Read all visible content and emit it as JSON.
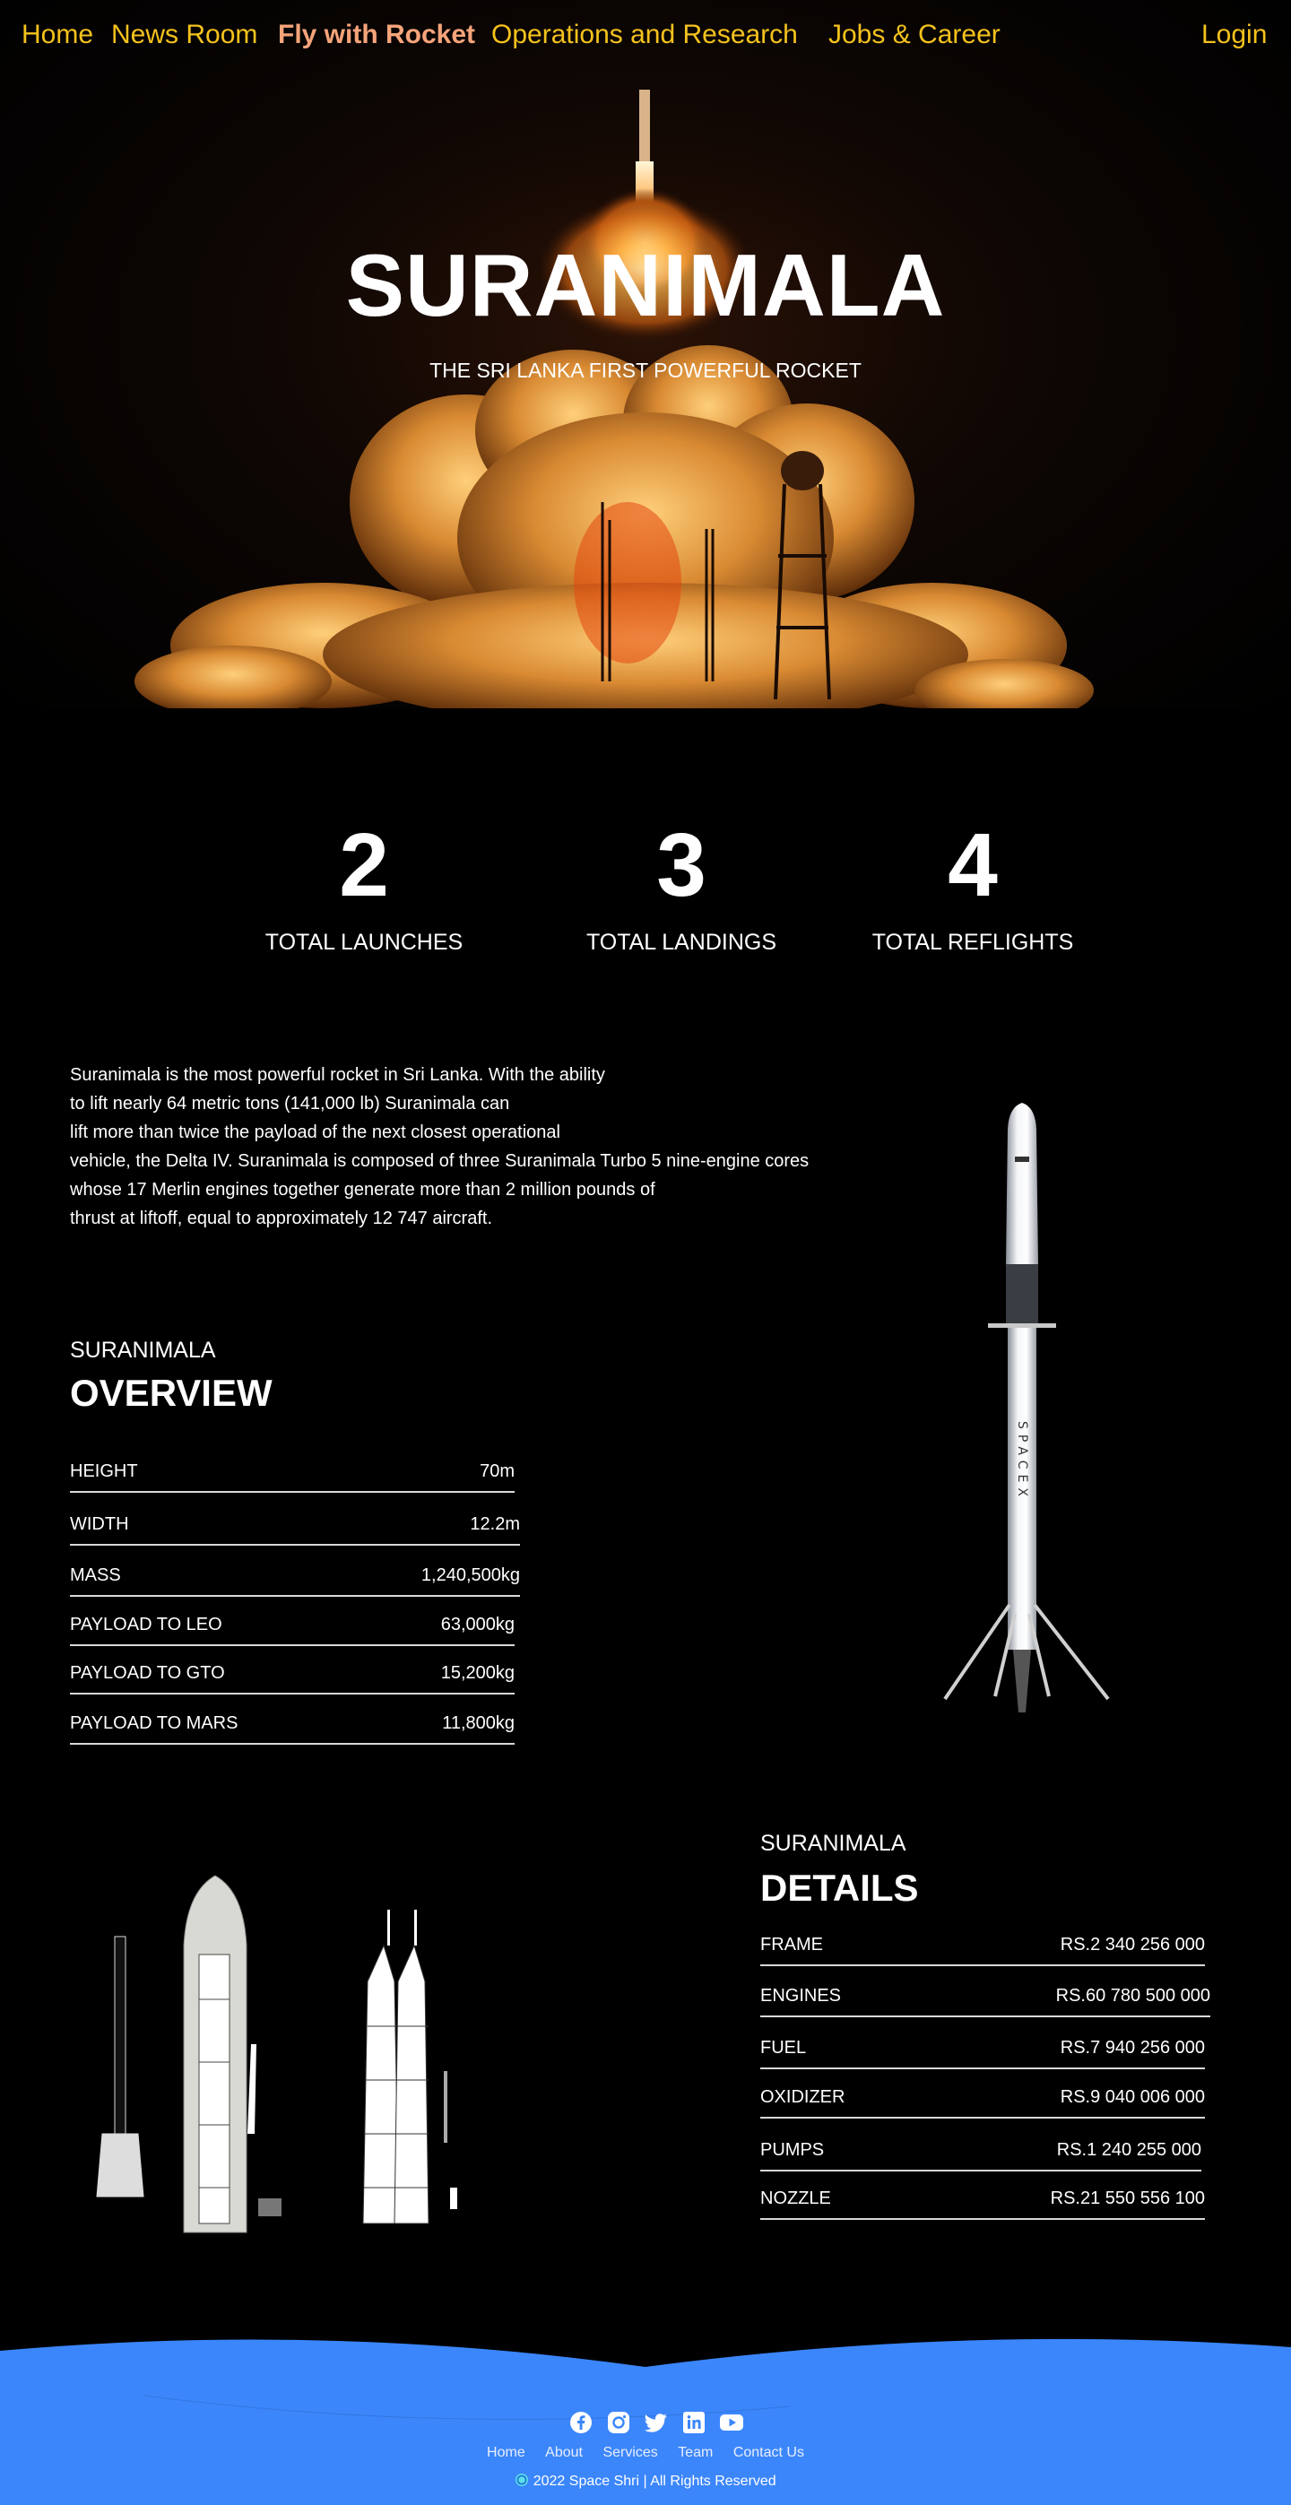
{
  "nav": {
    "home": "Home",
    "news": "News Room",
    "fly": "Fly with Rocket",
    "ops": "Operations and Research",
    "jobs": "Jobs & Career",
    "login": "Login"
  },
  "hero": {
    "title": "SURANIMALA",
    "subtitle": "THE SRI LANKA FIRST POWERFUL ROCKET"
  },
  "stats": [
    {
      "value": "2",
      "label": "TOTAL LAUNCHES"
    },
    {
      "value": "3",
      "label": "TOTAL LANDINGS"
    },
    {
      "value": "4",
      "label": "TOTAL REFLIGHTS"
    }
  ],
  "description": [
    "Suranimala is the most powerful rocket in Sri Lanka. With the ability",
    "to lift nearly 64 metric tons (141,000 lb) Suranimala can",
    "lift more than twice the payload of the next closest operational",
    "vehicle, the Delta IV. Suranimala is composed of three Suranimala Turbo 5 nine-engine cores",
    "whose 17 Merlin engines together generate more than 2 million pounds of",
    "thrust at liftoff, equal to approximately 12 747 aircraft."
  ],
  "overview": {
    "kicker": "SURANIMALA",
    "title": "OVERVIEW",
    "rows": [
      {
        "label": "HEIGHT",
        "value": "70m"
      },
      {
        "label": "WIDTH",
        "value": "12.2m"
      },
      {
        "label": "MASS",
        "value": "1,240,500kg"
      },
      {
        "label": "PAYLOAD TO LEO",
        "value": "63,000kg"
      },
      {
        "label": "PAYLOAD TO GTO",
        "value": "15,200kg"
      },
      {
        "label": "PAYLOAD TO MARS",
        "value": "11,800kg"
      }
    ]
  },
  "details": {
    "kicker": "SURANIMALA",
    "title": "DETAILS",
    "rows": [
      {
        "label": "FRAME",
        "value": "RS.2 340 256 000"
      },
      {
        "label": "ENGINES",
        "value": "RS.60 780 500 000"
      },
      {
        "label": "FUEL",
        "value": "RS.7 940 256 000"
      },
      {
        "label": "OXIDIZER",
        "value": "RS.9 040 006 000"
      },
      {
        "label": "PUMPS",
        "value": "RS.1 240 255 000"
      },
      {
        "label": "NOZZLE",
        "value": "RS.21 550 556 100"
      }
    ]
  },
  "rocket_text": "SPACEX",
  "footer": {
    "social": [
      "facebook-icon",
      "instagram-icon",
      "twitter-icon",
      "linkedin-icon",
      "youtube-icon"
    ],
    "links": [
      "Home",
      "About",
      "Services",
      "Team",
      "Contact Us"
    ],
    "copyright": "2022 Space Shri | All Rights Reserved"
  },
  "colors": {
    "nav": "#f4c21d",
    "nav_active": "#f6a47a",
    "footer": "#3b86fb"
  }
}
